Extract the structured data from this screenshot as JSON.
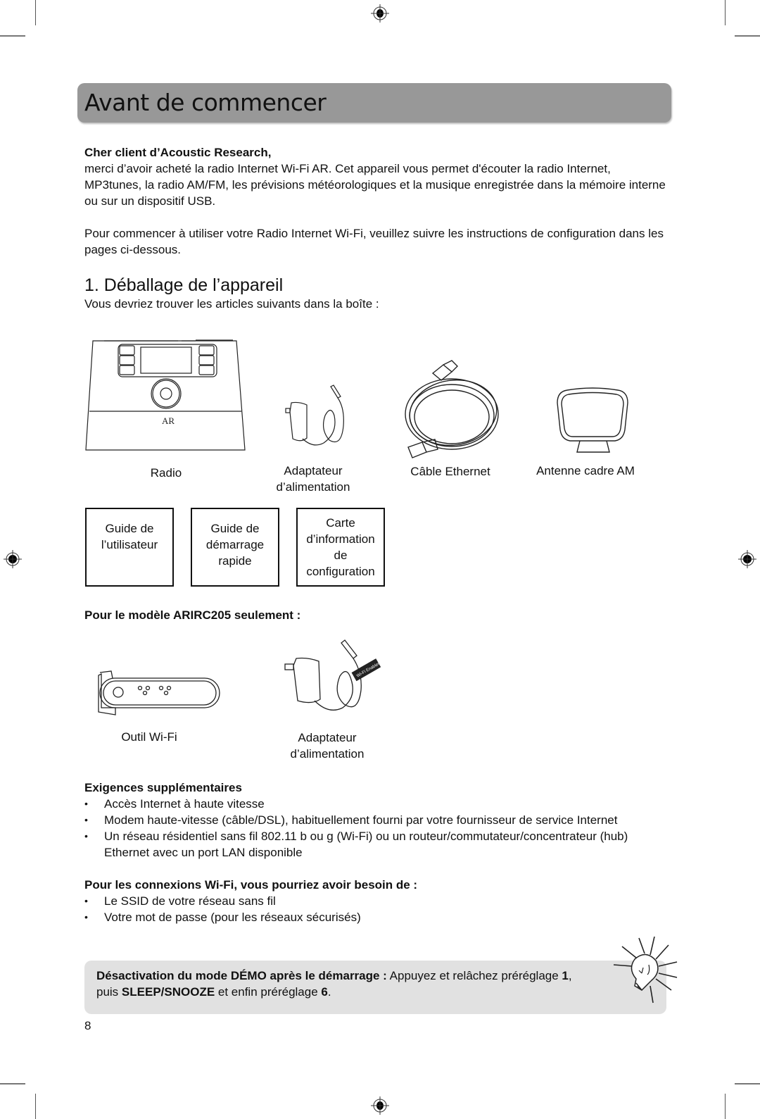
{
  "header": {
    "title": "Avant de commencer"
  },
  "intro": {
    "greeting": "Cher client d’Acoustic Research,",
    "paragraph1": "merci d’avoir acheté la radio Internet Wi-Fi AR. Cet appareil vous permet d'écouter la radio Internet, MP3tunes, la radio AM/FM, les prévisions météorologiques et la musique enregistrée dans la mémoire interne ou sur un dispositif USB.",
    "paragraph2": "Pour commencer à utiliser votre Radio Internet Wi-Fi, veuillez suivre les instructions de configuration dans les pages ci-dessous."
  },
  "section1": {
    "heading": "1. Déballage de l’appareil",
    "subtitle": "Vous devriez trouver les articles suivants dans la boîte :",
    "items": [
      {
        "icon": "radio-illustration",
        "label": "Radio"
      },
      {
        "icon": "power-adapter-illustration",
        "label": "Adaptateur\nd’alimentation"
      },
      {
        "icon": "ethernet-cable-illustration",
        "label": "Câble Ethernet"
      },
      {
        "icon": "am-loop-antenna-illustration",
        "label": "Antenne cadre AM"
      }
    ],
    "documents": [
      {
        "label": "Guide de\nl’utilisateur"
      },
      {
        "label": "Guide de\ndémarrage\nrapide"
      },
      {
        "label": "Carte\nd’information\nde\nconfiguration"
      }
    ],
    "model_only": {
      "heading": "Pour le modèle ARIRC205 seulement :",
      "items": [
        {
          "icon": "wifi-dongle-illustration",
          "label": "Outil Wi-Fi"
        },
        {
          "icon": "power-adapter-illustration",
          "label": "Adaptateur\nd’alimentation",
          "tag": "Wi-Fi Enabler"
        }
      ]
    }
  },
  "requirements": {
    "heading": "Exigences supplémentaires",
    "items": [
      "Accès Internet à haute vitesse",
      "Modem haute-vitesse (câble/DSL), habituellement fourni par votre fournisseur de service Internet",
      "Un réseau résidentiel sans fil 802.11 b ou g (Wi-Fi) ou un routeur/commutateur/concentrateur (hub) Ethernet avec un port LAN disponible"
    ]
  },
  "wifi": {
    "heading": "Pour les connexions Wi-Fi, vous pourriez avoir besoin de :",
    "items": [
      "Le SSID de votre réseau sans fil",
      "Votre mot de passe (pour les réseaux sécurisés)"
    ]
  },
  "tip": {
    "icon": "lightbulb-icon",
    "bold_lead": "Désactivation du mode DÉMO après le démarrage :",
    "text1": " Appuyez et relâchez préréglage ",
    "b1": "1",
    "text2": ",\npuis ",
    "b2": "SLEEP/SNOOZE",
    "text3": " et enfin préréglage ",
    "b3": "6",
    "text4": "."
  },
  "footer": {
    "page_number": "8"
  },
  "colors": {
    "title_bar": "#989898",
    "tip_box": "#e1e1e1"
  }
}
